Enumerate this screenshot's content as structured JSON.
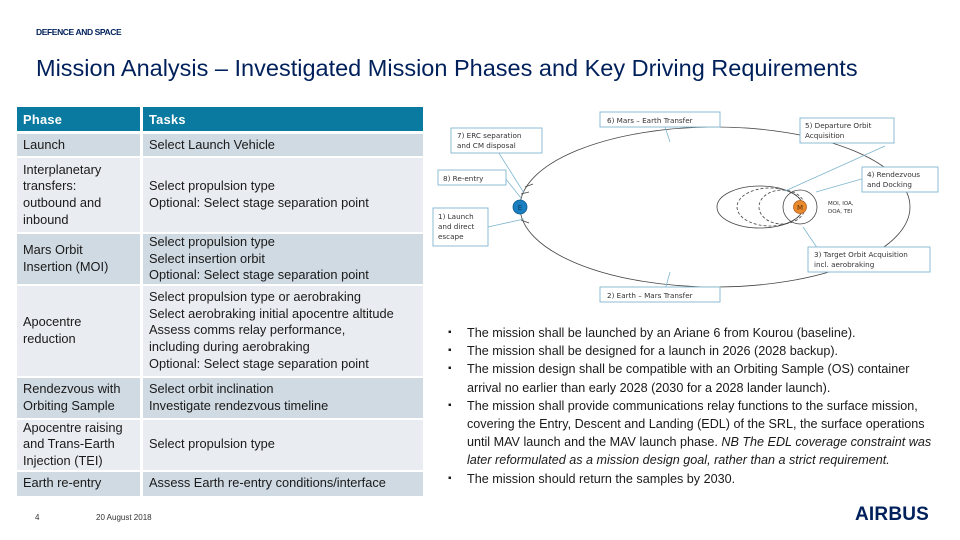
{
  "header": {
    "org": "DEFENCE AND SPACE",
    "title": "Mission Analysis – Investigated Mission Phases and Key Driving Requirements"
  },
  "table": {
    "columns": [
      "Phase",
      "Tasks"
    ],
    "rows": [
      {
        "phase": [
          "Launch"
        ],
        "tasks": [
          "Select Launch Vehicle"
        ]
      },
      {
        "phase": [
          "Interplanetary",
          "transfers:",
          "outbound and",
          "inbound"
        ],
        "tasks": [
          "Select propulsion type",
          "Optional: Select stage separation point"
        ]
      },
      {
        "phase": [
          "Mars Orbit",
          "Insertion (MOI)"
        ],
        "tasks": [
          "Select propulsion type",
          "Select insertion orbit",
          "Optional: Select stage separation point"
        ]
      },
      {
        "phase": [
          "Apocentre",
          "reduction"
        ],
        "tasks": [
          "Select propulsion type or aerobraking",
          "Select aerobraking initial apocentre altitude",
          "Assess comms relay performance,",
          "including during aerobraking",
          "Optional: Select stage separation point"
        ]
      },
      {
        "phase": [
          "Rendezvous with",
          "Orbiting Sample"
        ],
        "tasks": [
          "Select orbit inclination",
          "Investigate rendezvous timeline"
        ]
      },
      {
        "phase": [
          "Apocentre raising",
          "and Trans-Earth",
          "Injection (TEI)"
        ],
        "tasks": [
          "Select propulsion type"
        ]
      },
      {
        "phase": [
          "Earth re-entry"
        ],
        "tasks": [
          "Assess Earth re-entry conditions/interface"
        ]
      }
    ]
  },
  "diagram": {
    "earth_label": "E",
    "mars_label": "M",
    "mars_note": [
      "MOI, IOA,",
      "DOA, TEI"
    ],
    "labels": {
      "launch": [
        "1) Launch",
        "and direct",
        "escape"
      ],
      "earth_mars": [
        "2) Earth – Mars Transfer"
      ],
      "target_orbit": [
        "3) Target Orbit Acquisition",
        "incl. aerobraking"
      ],
      "rendezvous": [
        "4) Rendezvous",
        "and Docking"
      ],
      "departure": [
        "5) Departure Orbit",
        "Acquisition"
      ],
      "mars_earth": [
        "6) Mars – Earth Transfer"
      ],
      "erc": [
        "7) ERC separation",
        "and CM disposal"
      ],
      "reentry": [
        "8) Re-entry"
      ]
    },
    "colors": {
      "earth": "#1a7fc1",
      "mars": "#e88a2e",
      "box_border": "#7fb6cf"
    }
  },
  "requirements": [
    {
      "text": "The mission shall be launched by an Ariane 6 from Kourou (baseline).",
      "note": ""
    },
    {
      "text": "The mission shall be designed for a launch in 2026 (2028 backup).",
      "note": ""
    },
    {
      "text": "The mission design shall be compatible with an Orbiting Sample (OS) container arrival no earlier than early 2028 (2030 for a 2028 lander launch).",
      "note": ""
    },
    {
      "text": "The mission shall provide communications relay functions to the surface mission, covering the Entry, Descent and Landing (EDL) of the SRL, the surface operations until MAV launch and the MAV launch phase. ",
      "note": "NB The EDL coverage constraint was later reformulated as a mission design goal, rather than a strict requirement."
    },
    {
      "text": "The mission should return the samples by 2030.",
      "note": ""
    }
  ],
  "footer": {
    "page": "4",
    "date": "20 August 2018",
    "logo": "AIRBUS"
  },
  "colors": {
    "header_bg": "#0a7aa0",
    "row_dark": "#d0dae2",
    "row_light": "#e9edf1",
    "title": "#00205b"
  }
}
